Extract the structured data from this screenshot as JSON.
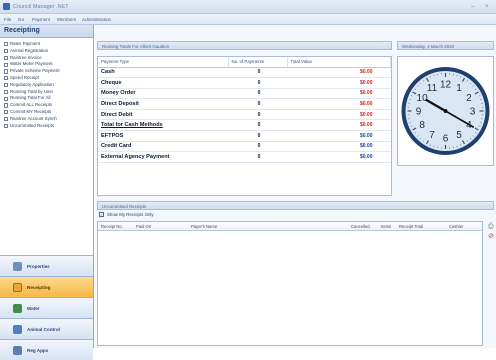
{
  "window": {
    "title": "Council Manager .NET",
    "minimize": "–",
    "close": "×"
  },
  "menu": [
    "File",
    "Go",
    "Payment",
    "Members",
    "Administration"
  ],
  "sidebar": {
    "header": "Receipting",
    "items": [
      "Rates Payment",
      "Animal Registration",
      "Raintree Invoice",
      "Water Meter Payment",
      "Private Scheme Payment",
      "Speed Receipt",
      "Regulatory Application",
      "Running Total by User",
      "Running Total For All",
      "Commit ALL Receipts",
      "Commit MY Receipts",
      "Raintree Account Synch",
      "Uncommitted Receipts"
    ],
    "modules": [
      {
        "label": "Properties",
        "color": "#6f8fb8",
        "active": false
      },
      {
        "label": "Receipting",
        "color": "#e8a53a",
        "active": true
      },
      {
        "label": "Water",
        "color": "#3f8d4a",
        "active": false
      },
      {
        "label": "Animal Control",
        "color": "#4f7fbf",
        "active": false
      },
      {
        "label": "Reg Apps",
        "color": "#5a7fb3",
        "active": false
      }
    ]
  },
  "running_totals": {
    "section_title": "Running Totals For Albert Gaudion",
    "columns": [
      "Payment Type",
      "No. of Payments",
      "Total Value"
    ],
    "rows": [
      {
        "type": "Cash",
        "count": "0",
        "value": "$0.00",
        "color": "#d11f1f",
        "underline": false
      },
      {
        "type": "Cheque",
        "count": "0",
        "value": "$0.00",
        "color": "#d11f1f",
        "underline": false
      },
      {
        "type": "Money Order",
        "count": "0",
        "value": "$0.00",
        "color": "#d11f1f",
        "underline": false
      },
      {
        "type": "Direct Deposit",
        "count": "0",
        "value": "$0.00",
        "color": "#d11f1f",
        "underline": false
      },
      {
        "type": "Direct Debit",
        "count": "0",
        "value": "$0.00",
        "color": "#d11f1f",
        "underline": false
      },
      {
        "type": "Total for Cash Methods",
        "count": "0",
        "value": "$0.00",
        "color": "#d11f1f",
        "underline": true
      },
      {
        "type": "EFTPOS",
        "count": "0",
        "value": "$0.00",
        "color": "#1d3f9a",
        "underline": false
      },
      {
        "type": "Credit Card",
        "count": "0",
        "value": "$0.00",
        "color": "#1d3f9a",
        "underline": false
      },
      {
        "type": "External Agency Payment",
        "count": "0",
        "value": "$0.00",
        "color": "#1d3f9a",
        "underline": false
      }
    ]
  },
  "clock": {
    "date_label": "Wednesday, 4 March 2020",
    "numerals": [
      "12",
      "1",
      "2",
      "3",
      "4",
      "5",
      "6",
      "7",
      "8",
      "9",
      "10",
      "11"
    ]
  },
  "uncommitted": {
    "section_title": "Uncommitted Receipts",
    "show_my_label": "Show My Receipts Only",
    "show_my_checked": true,
    "columns": [
      "Receipt No.",
      "Paid On",
      "Payer's Name",
      "Cancelled",
      "Items",
      "Receipt Total",
      "Cashier"
    ]
  }
}
